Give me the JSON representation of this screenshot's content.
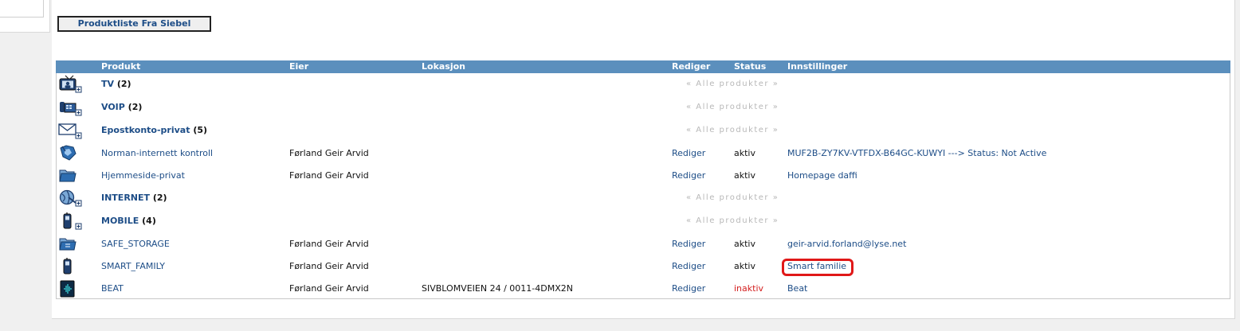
{
  "toolbar": {
    "siebel_button_label": "Produktliste Fra Siebel"
  },
  "table": {
    "headers": {
      "produkt": "Produkt",
      "eier": "Eier",
      "lokasjon": "Lokasjon",
      "rediger": "Rediger",
      "status": "Status",
      "innstillinger": "Innstillinger"
    },
    "rows": [
      {
        "type": "group",
        "icon": "tv-icon",
        "name": "TV",
        "count": "(2)",
        "all_products": "« Alle produkter »"
      },
      {
        "type": "group",
        "icon": "voip-phone-icon",
        "name": "VOIP",
        "count": "(2)",
        "all_products": "« Alle produkter »"
      },
      {
        "type": "group",
        "icon": "email-envelope-icon",
        "name": "Epostkonto-privat",
        "count": "(5)",
        "all_products": "« Alle produkter »"
      },
      {
        "type": "item",
        "icon": "security-shield-icon",
        "name": "Norman-internett kontroll",
        "owner": "Førland Geir Arvid",
        "location": "",
        "edit": "Rediger",
        "status": "aktiv",
        "settings": "MUF2B-ZY7KV-VTFDX-B64GC-KUWYI ---> Status: Not Active"
      },
      {
        "type": "item",
        "icon": "folder-icon",
        "name": "Hjemmeside-privat",
        "owner": "Førland Geir Arvid",
        "location": "",
        "edit": "Rediger",
        "status": "aktiv",
        "settings": "Homepage daffi"
      },
      {
        "type": "group",
        "icon": "internet-globe-icon",
        "name": "INTERNET",
        "count": "(2)",
        "all_products": "« Alle produkter »"
      },
      {
        "type": "group",
        "icon": "mobile-phone-icon",
        "name": "MOBILE",
        "count": "(4)",
        "all_products": "« Alle produkter »"
      },
      {
        "type": "item",
        "icon": "storage-folder-icon",
        "name": "SAFE_STORAGE",
        "owner": "Førland Geir Arvid",
        "location": "",
        "edit": "Rediger",
        "status": "aktiv",
        "settings": "geir-arvid.forland@lyse.net"
      },
      {
        "type": "item",
        "icon": "mobile-phone-icon",
        "name": "SMART_FAMILY",
        "owner": "Førland Geir Arvid",
        "location": "",
        "edit": "Rediger",
        "status": "aktiv",
        "settings": "Smart familie"
      },
      {
        "type": "item",
        "icon": "music-beat-icon",
        "name": "BEAT",
        "owner": "Førland Geir Arvid",
        "location": "SIVBLOMVEIEN 24 / 0011-4DMX2N",
        "edit": "Rediger",
        "status": "inaktiv",
        "settings": "Beat"
      }
    ]
  },
  "colors": {
    "header_bg": "#5b8fbd",
    "link": "#1d4d87",
    "inactive": "#d42020",
    "highlight": "#e01818",
    "muted": "#b8b8b8"
  }
}
